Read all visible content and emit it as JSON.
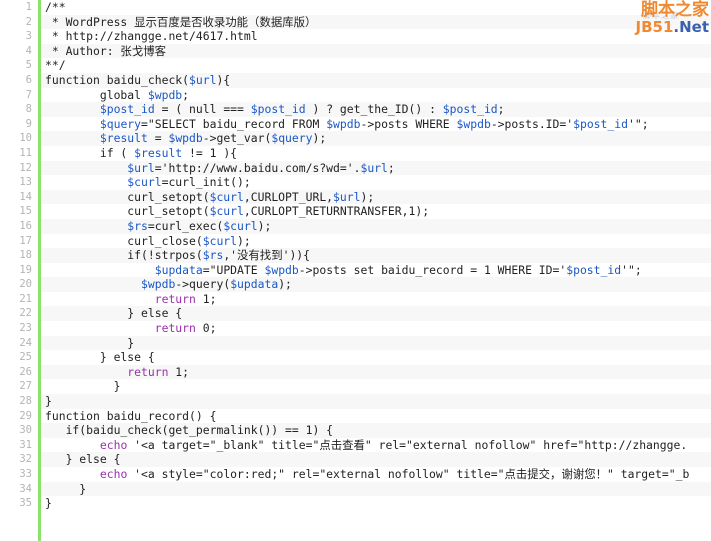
{
  "app": {
    "type": "code-snippet-viewer",
    "language": "PHP",
    "total_lines": 35,
    "colors": {
      "background": "#ffffff",
      "alt_row": "#f7f7f7",
      "gutter_text": "#b4b4b4",
      "green_rule": "#8ae26a",
      "variable": "#1a57c8",
      "keyword_return": "#9b2fae",
      "text": "#222222",
      "watermark_orange": "#f08020",
      "watermark_blue": "#2a54a8"
    }
  },
  "watermark": {
    "cn_text": "脚本之家",
    "en_prefix": "JB51",
    "en_suffix": ".Net",
    "ghost_text": "脚本之家"
  },
  "gutter": {
    "numbers": [
      "1",
      "2",
      "3",
      "4",
      "5",
      "6",
      "7",
      "8",
      "9",
      "10",
      "11",
      "12",
      "13",
      "14",
      "15",
      "16",
      "17",
      "18",
      "19",
      "20",
      "21",
      "22",
      "23",
      "24",
      "25",
      "26",
      "27",
      "28",
      "29",
      "30",
      "31",
      "32",
      "33",
      "34",
      "35"
    ]
  },
  "code": {
    "lines": [
      {
        "n": 1,
        "tokens": [
          {
            "t": "/**",
            "c": "comment"
          }
        ]
      },
      {
        "n": 2,
        "tokens": [
          {
            "t": " * WordPress 显示百度是否收录功能（数据库版）",
            "c": "comment"
          }
        ]
      },
      {
        "n": 3,
        "tokens": [
          {
            "t": " * http://zhangge.net/4617.html",
            "c": "comment"
          }
        ]
      },
      {
        "n": 4,
        "tokens": [
          {
            "t": " * Author: 张戈博客",
            "c": "comment"
          }
        ]
      },
      {
        "n": 5,
        "tokens": [
          {
            "t": "**/",
            "c": "comment"
          }
        ]
      },
      {
        "n": 6,
        "tokens": [
          {
            "t": "function baidu_check(",
            "c": "plain"
          },
          {
            "t": "$url",
            "c": "var"
          },
          {
            "t": "){",
            "c": "plain"
          }
        ]
      },
      {
        "n": 7,
        "tokens": [
          {
            "t": "        global ",
            "c": "plain"
          },
          {
            "t": "$wpdb",
            "c": "var"
          },
          {
            "t": ";",
            "c": "plain"
          }
        ]
      },
      {
        "n": 8,
        "tokens": [
          {
            "t": "        ",
            "c": "plain"
          },
          {
            "t": "$post_id",
            "c": "var"
          },
          {
            "t": " = ( null === ",
            "c": "plain"
          },
          {
            "t": "$post_id",
            "c": "var"
          },
          {
            "t": " ) ? get_the_ID() : ",
            "c": "plain"
          },
          {
            "t": "$post_id",
            "c": "var"
          },
          {
            "t": ";",
            "c": "plain"
          }
        ]
      },
      {
        "n": 9,
        "tokens": [
          {
            "t": "        ",
            "c": "plain"
          },
          {
            "t": "$query",
            "c": "var"
          },
          {
            "t": "=\"SELECT baidu_record FROM ",
            "c": "plain"
          },
          {
            "t": "$wpdb",
            "c": "var"
          },
          {
            "t": "->posts WHERE ",
            "c": "plain"
          },
          {
            "t": "$wpdb",
            "c": "var"
          },
          {
            "t": "->posts.ID='",
            "c": "plain"
          },
          {
            "t": "$post_id",
            "c": "var"
          },
          {
            "t": "'\";",
            "c": "plain"
          }
        ]
      },
      {
        "n": 10,
        "tokens": [
          {
            "t": "        ",
            "c": "plain"
          },
          {
            "t": "$result",
            "c": "var"
          },
          {
            "t": " = ",
            "c": "plain"
          },
          {
            "t": "$wpdb",
            "c": "var"
          },
          {
            "t": "->get_var(",
            "c": "plain"
          },
          {
            "t": "$query",
            "c": "var"
          },
          {
            "t": ");",
            "c": "plain"
          }
        ]
      },
      {
        "n": 11,
        "tokens": [
          {
            "t": "        if ( ",
            "c": "plain"
          },
          {
            "t": "$result",
            "c": "var"
          },
          {
            "t": " != 1 ){",
            "c": "plain"
          }
        ]
      },
      {
        "n": 12,
        "tokens": [
          {
            "t": "            ",
            "c": "plain"
          },
          {
            "t": "$url",
            "c": "var"
          },
          {
            "t": "='http://www.baidu.com/s?wd='.",
            "c": "plain"
          },
          {
            "t": "$url",
            "c": "var"
          },
          {
            "t": ";",
            "c": "plain"
          }
        ]
      },
      {
        "n": 13,
        "tokens": [
          {
            "t": "            ",
            "c": "plain"
          },
          {
            "t": "$curl",
            "c": "var"
          },
          {
            "t": "=curl_init();",
            "c": "plain"
          }
        ]
      },
      {
        "n": 14,
        "tokens": [
          {
            "t": "            curl_setopt(",
            "c": "plain"
          },
          {
            "t": "$curl",
            "c": "var"
          },
          {
            "t": ",CURLOPT_URL,",
            "c": "plain"
          },
          {
            "t": "$url",
            "c": "var"
          },
          {
            "t": ");",
            "c": "plain"
          }
        ]
      },
      {
        "n": 15,
        "tokens": [
          {
            "t": "            curl_setopt(",
            "c": "plain"
          },
          {
            "t": "$curl",
            "c": "var"
          },
          {
            "t": ",CURLOPT_RETURNTRANSFER,1);",
            "c": "plain"
          }
        ]
      },
      {
        "n": 16,
        "tokens": [
          {
            "t": "            ",
            "c": "plain"
          },
          {
            "t": "$rs",
            "c": "var"
          },
          {
            "t": "=curl_exec(",
            "c": "plain"
          },
          {
            "t": "$curl",
            "c": "var"
          },
          {
            "t": ");",
            "c": "plain"
          }
        ]
      },
      {
        "n": 17,
        "tokens": [
          {
            "t": "            curl_close(",
            "c": "plain"
          },
          {
            "t": "$curl",
            "c": "var"
          },
          {
            "t": ");",
            "c": "plain"
          }
        ]
      },
      {
        "n": 18,
        "tokens": [
          {
            "t": "            if(!strpos(",
            "c": "plain"
          },
          {
            "t": "$rs",
            "c": "var"
          },
          {
            "t": ",'没有找到')){",
            "c": "plain"
          }
        ]
      },
      {
        "n": 19,
        "tokens": [
          {
            "t": "                ",
            "c": "plain"
          },
          {
            "t": "$updata",
            "c": "var"
          },
          {
            "t": "=\"UPDATE ",
            "c": "plain"
          },
          {
            "t": "$wpdb",
            "c": "var"
          },
          {
            "t": "->posts set baidu_record = 1 WHERE ID='",
            "c": "plain"
          },
          {
            "t": "$post_id",
            "c": "var"
          },
          {
            "t": "'\";",
            "c": "plain"
          }
        ]
      },
      {
        "n": 20,
        "tokens": [
          {
            "t": "              ",
            "c": "plain"
          },
          {
            "t": "$wpdb",
            "c": "var"
          },
          {
            "t": "->query(",
            "c": "plain"
          },
          {
            "t": "$updata",
            "c": "var"
          },
          {
            "t": ");",
            "c": "plain"
          }
        ]
      },
      {
        "n": 21,
        "tokens": [
          {
            "t": "                ",
            "c": "plain"
          },
          {
            "t": "return",
            "c": "ret"
          },
          {
            "t": " 1;",
            "c": "plain"
          }
        ]
      },
      {
        "n": 22,
        "tokens": [
          {
            "t": "            } else {",
            "c": "plain"
          }
        ]
      },
      {
        "n": 23,
        "tokens": [
          {
            "t": "                ",
            "c": "plain"
          },
          {
            "t": "return",
            "c": "ret"
          },
          {
            "t": " 0;",
            "c": "plain"
          }
        ]
      },
      {
        "n": 24,
        "tokens": [
          {
            "t": "            }",
            "c": "plain"
          }
        ]
      },
      {
        "n": 25,
        "tokens": [
          {
            "t": "        } else {",
            "c": "plain"
          }
        ]
      },
      {
        "n": 26,
        "tokens": [
          {
            "t": "            ",
            "c": "plain"
          },
          {
            "t": "return",
            "c": "ret"
          },
          {
            "t": " 1;",
            "c": "plain"
          }
        ]
      },
      {
        "n": 27,
        "tokens": [
          {
            "t": "          }",
            "c": "plain"
          }
        ]
      },
      {
        "n": 28,
        "tokens": [
          {
            "t": "}",
            "c": "plain"
          }
        ]
      },
      {
        "n": 29,
        "tokens": [
          {
            "t": "function baidu_record() {",
            "c": "plain"
          }
        ]
      },
      {
        "n": 30,
        "tokens": [
          {
            "t": "   if(baidu_check(get_permalink()) == 1) {",
            "c": "plain"
          }
        ]
      },
      {
        "n": 31,
        "tokens": [
          {
            "t": "        ",
            "c": "plain"
          },
          {
            "t": "echo",
            "c": "echo"
          },
          {
            "t": " '<a target=\"_blank\" title=\"点击查看\" rel=\"external nofollow\" href=\"http://zhangge.",
            "c": "plain"
          }
        ]
      },
      {
        "n": 32,
        "tokens": [
          {
            "t": "   } else {",
            "c": "plain"
          }
        ]
      },
      {
        "n": 33,
        "tokens": [
          {
            "t": "        ",
            "c": "plain"
          },
          {
            "t": "echo",
            "c": "echo"
          },
          {
            "t": " '<a style=\"color:red;\" rel=\"external nofollow\" title=\"点击提交，谢谢您！\" target=\"_b",
            "c": "plain"
          }
        ]
      },
      {
        "n": 34,
        "tokens": [
          {
            "t": "     }",
            "c": "plain"
          }
        ]
      },
      {
        "n": 35,
        "tokens": [
          {
            "t": "}",
            "c": "plain"
          }
        ]
      }
    ]
  }
}
